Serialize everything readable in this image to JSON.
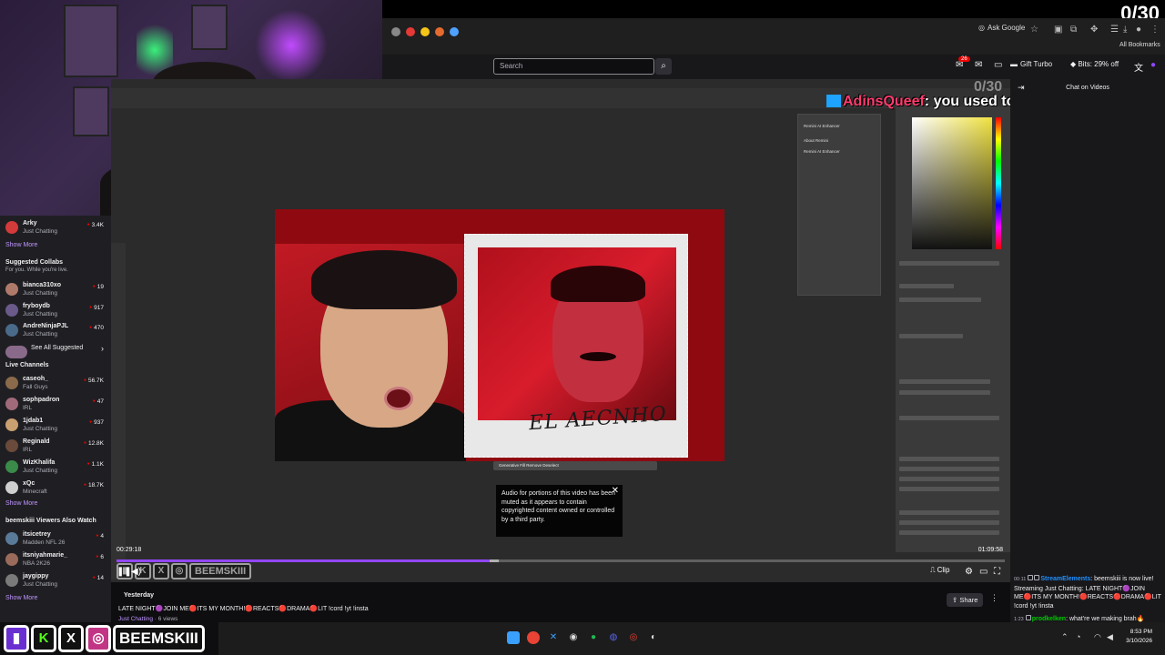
{
  "overlay": {
    "counter": "0/30",
    "chat_user": "AdinsQueef",
    "chat_text": ": you used to have motivation"
  },
  "browser": {
    "ask_google": "Ask Google",
    "all_bookmarks": "All Bookmarks"
  },
  "nav": {
    "search_placeholder": "Search",
    "notif_count": "26",
    "gift_turbo": "Gift Turbo",
    "bits": "Bits: 29% off"
  },
  "sidebar": {
    "followed": [
      {
        "name": "Arky",
        "category": "Just Chatting",
        "viewers": "3.4K",
        "color": "#d33a3a"
      }
    ],
    "show_more_1": "Show More",
    "collabs_title": "Suggested Collabs",
    "collabs_sub": "For you. While you're live.",
    "collabs": [
      {
        "name": "bianca310xo",
        "category": "Just Chatting",
        "viewers": "19",
        "color": "#b07a6a"
      },
      {
        "name": "fryboydb",
        "category": "Just Chatting",
        "viewers": "917",
        "color": "#6a5a8a"
      },
      {
        "name": "AndreNinjaPJL",
        "category": "Just Chatting",
        "viewers": "470",
        "color": "#4a6a8a"
      }
    ],
    "see_all": "See All Suggested",
    "live_title": "Live Channels",
    "live": [
      {
        "name": "caseoh_",
        "category": "Fall Guys",
        "viewers": "56.7K",
        "color": "#8a6a4a"
      },
      {
        "name": "sophpadron",
        "category": "IRL",
        "viewers": "47",
        "color": "#a06a7a"
      },
      {
        "name": "1jdab1",
        "category": "Just Chatting",
        "viewers": "937",
        "color": "#caa070"
      },
      {
        "name": "Reginald",
        "category": "IRL",
        "viewers": "12.8K",
        "color": "#6a4a3a"
      },
      {
        "name": "WizKhalifa",
        "category": "Just Chatting",
        "viewers": "1.1K",
        "color": "#3a8a4a"
      },
      {
        "name": "xQc",
        "category": "Minecraft",
        "viewers": "18.7K",
        "color": "#cfcfcf"
      }
    ],
    "show_more_2": "Show More",
    "also_title": "beemskiii Viewers Also Watch",
    "also": [
      {
        "name": "itsicetrey",
        "category": "Madden NFL 26",
        "viewers": "4",
        "color": "#5a7a9a"
      },
      {
        "name": "itsniyahmarie_",
        "category": "NBA 2K26",
        "viewers": "6",
        "color": "#9a6a5a"
      },
      {
        "name": "jaygippy",
        "category": "Just Chatting",
        "viewers": "14",
        "color": "#7a7a7a"
      }
    ],
    "show_more_3": "Show More"
  },
  "photoshop": {
    "remini_title": "Remini AI Enhancer",
    "about": "About Remini",
    "remini_item": "Remini AI Enhancer",
    "caption": "EL AECNHO",
    "gen_toolbar": "Generative Fill   Remove   Deselect"
  },
  "player": {
    "mute_notice": "Audio for portions of this video has been muted as it appears to contain copyrighted content owned or controlled by a third party.",
    "time_current": "00:29:18",
    "time_total": "01:09:58",
    "progress": 0.42,
    "buffered": 0.43,
    "clip": "Clip"
  },
  "info": {
    "date": "Yesterday",
    "title": "LATE NIGHT🟣JOIN ME🔴ITS MY MONTH!🔴REACTS🔴DRAMA🔴LIT !cord !yt !insta",
    "category": "Just Chatting",
    "views": "6 views",
    "share": "Share"
  },
  "chat": {
    "title": "Chat on Videos",
    "messages": [
      {
        "ts": "00:11",
        "user": "StreamElements",
        "text": ": beemskiii is now live! Streaming Just Chatting: LATE NIGHT🟣JOIN ME🔴ITS MY MONTH!🔴REACTS🔴DRAMA🔴LIT !cord !yt !insta"
      },
      {
        "ts": "1:23",
        "user": "prodkelken",
        "text": ": what're we making brah🔥"
      }
    ]
  },
  "brand": {
    "handle": "BEEMSKIII"
  },
  "taskbar": {
    "time": "8:53 PM",
    "date": "3/10/2026"
  }
}
